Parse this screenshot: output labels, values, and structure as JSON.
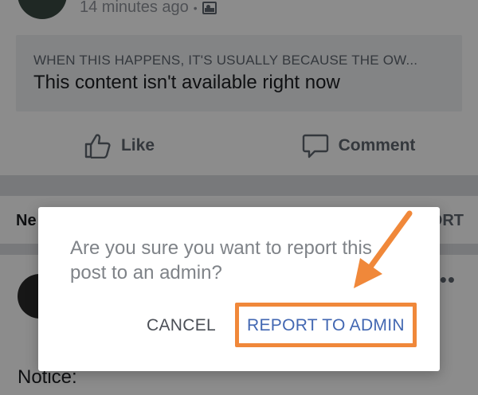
{
  "post": {
    "timestamp": "14 minutes ago",
    "separator": "•",
    "audience_icon": "photo-icon"
  },
  "unavailable": {
    "kicker": "WHEN THIS HAPPENS, IT'S USUALLY BECAUSE THE OW...",
    "title": "This content isn't available right now"
  },
  "actions": {
    "like_label": "Like",
    "like_icon": "thumbs-up-icon",
    "comment_label": "Comment",
    "comment_icon": "comment-icon"
  },
  "feed_bar": {
    "left_fragment": "Ne",
    "right_fragment": "ORT"
  },
  "post2": {
    "more": "•••",
    "notice": "Notice:"
  },
  "dialog": {
    "message": "Are you sure you want to report this post to an admin?",
    "cancel_label": "CANCEL",
    "report_label": "REPORT TO ADMIN"
  },
  "colors": {
    "annotation": "#f0883a",
    "primary_button": "#4267b2"
  }
}
